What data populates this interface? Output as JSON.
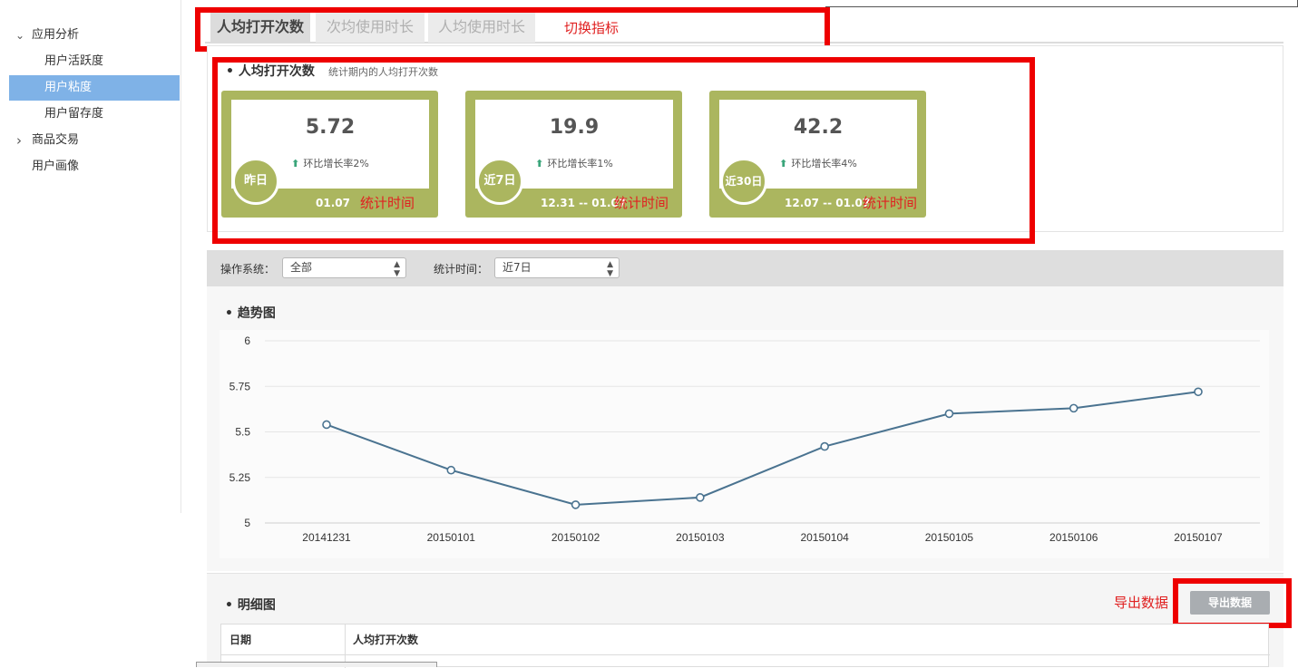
{
  "sidebar": {
    "items": [
      {
        "label": "应用分析",
        "chevron": "⌄"
      },
      {
        "label": "用户活跃度"
      },
      {
        "label": "用户粘度"
      },
      {
        "label": "用户留存度"
      },
      {
        "label": "商品交易",
        "chevron": "›"
      },
      {
        "label": "用户画像"
      }
    ]
  },
  "tabs": [
    {
      "label": "人均打开次数",
      "state": "active"
    },
    {
      "label": "次均使用时长",
      "state": "inactive"
    },
    {
      "label": "人均使用时长",
      "state": "inactive"
    }
  ],
  "annotations": {
    "switch_metric": "切换指标",
    "stat_time": "统计时间",
    "export_data": "导出数据",
    "color": "#ee0000"
  },
  "stats": {
    "title": "人均打开次数",
    "subtitle": "统计期内的人均打开次数",
    "cards": [
      {
        "value": "5.72",
        "growth": "环比增长率2%",
        "period": "昨日",
        "date": "01.07"
      },
      {
        "value": "19.9",
        "growth": "环比增长率1%",
        "period": "近7日",
        "date": "12.31 -- 01.07"
      },
      {
        "value": "42.2",
        "growth": "环比增长率4%",
        "period": "近30日",
        "date": "12.07 -- 01.07"
      }
    ],
    "card_color": "#abb65f",
    "growth_icon": "arrow-up-icon"
  },
  "filters": {
    "os_label": "操作系统：",
    "os_value": "全部",
    "time_label": "统计时间：",
    "time_value": "近7日"
  },
  "trend": {
    "title": "趋势图"
  },
  "chart_data": {
    "type": "line",
    "x": [
      "20141231",
      "20150101",
      "20150102",
      "20150103",
      "20150104",
      "20150105",
      "20150106",
      "20150107"
    ],
    "series": [
      {
        "values": [
          5.54,
          5.29,
          5.1,
          5.14,
          5.42,
          5.6,
          5.63,
          5.72
        ],
        "color": "#4a7390"
      }
    ],
    "ylim": [
      5,
      6
    ],
    "yticks": [
      "6",
      "5.75",
      "5.5",
      "5.25",
      "5"
    ],
    "grid": true
  },
  "detail": {
    "title": "明细图",
    "export_button": "导出数据",
    "columns": [
      "日期",
      "人均打开次数"
    ]
  }
}
